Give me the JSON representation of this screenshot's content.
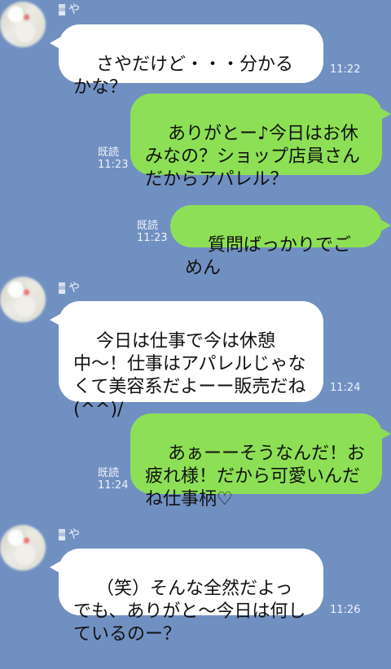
{
  "messages": [
    {
      "sender": "や",
      "text": "さやだけど・・・分かるかな？",
      "time": "11:22"
    },
    {
      "text": "ありがとー♪今日はお休みなの？ショップ店員さんだからアパレル？",
      "read": "既読",
      "time": "11:23"
    },
    {
      "text": "質問ばっかりでごめん",
      "read": "既読",
      "time": "11:23"
    },
    {
      "sender": "や",
      "text": "今日は仕事で今は休憩中〜！仕事はアパレルじゃなくて美容系だよーー販売だね(^^)/",
      "time": "11:24"
    },
    {
      "text": "あぁーーそうなんだ！お疲れ様！だから可愛いんだね仕事柄♡",
      "read": "既読",
      "time": "11:24"
    },
    {
      "sender": "や",
      "text": "（笑）そんな全然だよっでも、ありがと〜今日は何しているのー？",
      "time": "11:26"
    }
  ]
}
